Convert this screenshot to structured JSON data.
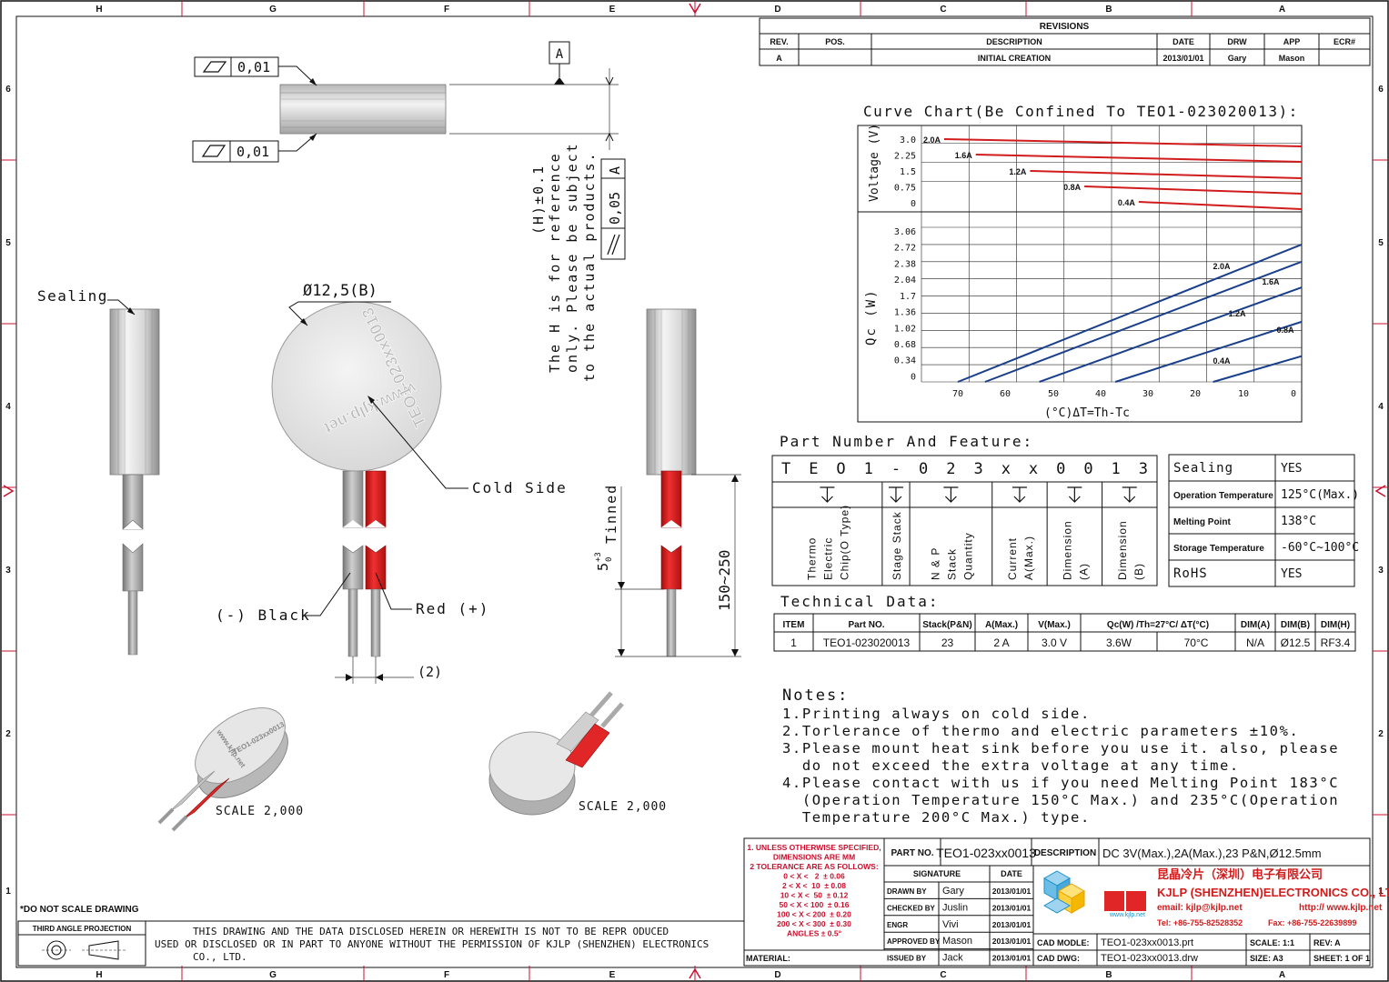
{
  "border": {
    "cols": [
      "H",
      "G",
      "F",
      "E",
      "D",
      "C",
      "B",
      "A"
    ],
    "rows": [
      "6",
      "5",
      "4",
      "3",
      "2",
      "1"
    ]
  },
  "revisions": {
    "title": "REVISIONS",
    "headers": [
      "REV.",
      "POS.",
      "DESCRIPTION",
      "DATE",
      "DRW",
      "APP",
      "ECR#"
    ],
    "row": [
      "A",
      "",
      "INITIAL CREATION",
      "2013/01/01",
      "Gary",
      "Mason",
      ""
    ]
  },
  "views": {
    "flatness_value": "0,01",
    "datum": "A",
    "parallel": {
      "value": "0,05",
      "datum": "A"
    },
    "height_note": [
      "(H)±0.1",
      "The H is for reference",
      "only. Please be subject",
      "to the actual products."
    ],
    "sealing": "Sealing",
    "diameter": "Ø12,5(B)",
    "disk_text": {
      "url": "www.kjlp.net",
      "part": "TEO1-023xx0013"
    },
    "cold_side": "Cold Side",
    "black": "(-) Black",
    "red": "Red (+)",
    "pitch": "(2)",
    "tinned": "5",
    "tinned_sup": "+3",
    "tinned_sub": "0",
    "tinned_label": "Tinned",
    "wire_length": "150~250",
    "scale1": "SCALE  2,000",
    "scale2": "SCALE  2,000"
  },
  "curve": {
    "title": "Curve Chart(Be Confined To TEO1-023020013):"
  },
  "chart_data": [
    {
      "type": "line",
      "ylabel": "Voltage (V)",
      "y_ticks": [
        "3.0",
        "2.25",
        "1.5",
        "0.75",
        "0"
      ],
      "x_range": [
        70,
        0
      ],
      "series": [
        {
          "name": "2.0A",
          "points": [
            [
              70,
              3.0
            ],
            [
              0,
              2.8
            ]
          ]
        },
        {
          "name": "1.6A",
          "points": [
            [
              60,
              2.25
            ],
            [
              0,
              2.05
            ]
          ]
        },
        {
          "name": "1.2A",
          "points": [
            [
              50,
              1.5
            ],
            [
              0,
              1.35
            ]
          ]
        },
        {
          "name": "0.8A",
          "points": [
            [
              40,
              0.75
            ],
            [
              0,
              0.6
            ]
          ]
        },
        {
          "name": "0.4A",
          "points": [
            [
              30,
              0.0
            ],
            [
              0,
              0.0
            ]
          ]
        }
      ]
    },
    {
      "type": "line",
      "ylabel": "Qc (W)",
      "xlabel": "(°C)ΔT=Th-Tc",
      "x_ticks": [
        "70",
        "60",
        "50",
        "40",
        "30",
        "20",
        "10",
        "0"
      ],
      "y_ticks": [
        "3.06",
        "2.72",
        "2.38",
        "2.04",
        "1.7",
        "1.36",
        "1.02",
        "0.68",
        "0.34",
        "0"
      ],
      "series": [
        {
          "name": "2.0A",
          "points": [
            [
              70,
              0
            ],
            [
              0,
              2.72
            ]
          ]
        },
        {
          "name": "1.6A",
          "points": [
            [
              65,
              0
            ],
            [
              0,
              2.38
            ]
          ]
        },
        {
          "name": "1.2A",
          "points": [
            [
              55,
              0
            ],
            [
              0,
              1.87
            ]
          ]
        },
        {
          "name": "0.8A",
          "points": [
            [
              41,
              0
            ],
            [
              0,
              1.19
            ]
          ]
        },
        {
          "name": "0.4A",
          "points": [
            [
              23,
              0
            ],
            [
              0,
              0.51
            ]
          ]
        }
      ]
    }
  ],
  "partnumber": {
    "title": "Part Number And Feature:",
    "chars": [
      "T",
      "E",
      "O",
      "1",
      "-",
      "0",
      "2",
      "3",
      "x",
      "x",
      "0",
      "0",
      "1",
      "3"
    ],
    "descriptions": [
      "Thermo Electric Chip(O Type)",
      "Stage Stack",
      "N & P Stack Quantity",
      "Current A(Max.)",
      "Dimension (A)",
      "Dimension (B)"
    ],
    "features": [
      [
        "Sealing",
        "YES"
      ],
      [
        "Operation Temperature",
        "125°C(Max.)"
      ],
      [
        "Melting Point",
        "138°C"
      ],
      [
        "Storage Temperature",
        "-60°C~100°C"
      ],
      [
        "RoHS",
        "YES"
      ]
    ]
  },
  "technical": {
    "title": "Technical Data:",
    "headers": [
      "ITEM",
      "Part NO.",
      "Stack(P&N)",
      "A(Max.)",
      "V(Max.)",
      "Qc(W) /Th=27°C/ ΔT(°C)",
      "DIM(A)",
      "DIM(B)",
      "DIM(H)"
    ],
    "row": [
      "1",
      "TEO1-023020013",
      "23",
      "2 A",
      "3.0 V",
      "3.6W",
      "70°C",
      "N/A",
      "Ø12.5",
      "RF3.4"
    ]
  },
  "notes": {
    "title": "Notes:",
    "lines": [
      "1.Printing always on cold side.",
      "2.Torlerance of thermo and electric parameters ±10%.",
      "3.Please mount heat sink before you use it. also, please",
      "  do not exceed the extra voltage at any time.",
      "4.Please contact with us if you need Melting Point 183°C",
      "  (Operation Temperature 150°C Max.) and 235°C(Operation",
      "  Temperature 200°C Max.) type."
    ]
  },
  "titleblock": {
    "tolerance": [
      "1. UNLESS OTHERWISE SPECIFIED,",
      "DIMENSIONS ARE MM",
      "2 TOLERANCE ARE AS FOLLOWS:",
      "0 < X <   2  ± 0.06",
      "2 < X <  10  ± 0.08",
      "10 < X <  50  ± 0.12",
      "50 < X < 100  ± 0.16",
      "100 < X < 200  ± 0.20",
      "200 < X < 300  ± 0.30",
      "ANGLES ± 0.5°"
    ],
    "part_no_label": "PART NO.",
    "part_no": "TEO1-023xx0013",
    "description_label": "DESCRIPTION",
    "description": "DC 3V(Max.),2A(Max.),23 P&N,Ø12.5mm",
    "signature_label": "SIGNATURE",
    "date_label": "DATE",
    "sign_rows": [
      [
        "DRAWN BY",
        "Gary",
        "2013/01/01"
      ],
      [
        "CHECKED BY",
        "Juslin",
        "2013/01/01"
      ],
      [
        "ENGR",
        "Vivi",
        "2013/01/01"
      ],
      [
        "APPROVED BY",
        "Mason",
        "2013/01/01"
      ],
      [
        "ISSUED BY",
        "Jack",
        "2013/01/01"
      ]
    ],
    "company_cn": "昆晶冷片（深圳）电子有限公司",
    "company_en": "KJLP (SHENZHEN)ELECTRONICS CO., LTD",
    "email": "email: kjlp@kjlp.net",
    "http": "http:// www.kjlp.net",
    "tel": "Tel: +86-755-82528352",
    "fax": "Fax: +86-755-22639899",
    "logo_url": "www.kjlp.net",
    "cad_model_label": "CAD MODLE:",
    "cad_model": "TEO1-023xx0013.prt",
    "cad_dwg_label": "CAD DWG:",
    "cad_dwg": "TEO1-023xx0013.drw",
    "scale_label": "SCALE: 1:1",
    "rev_label": "REV: A",
    "size_label": "SIZE: A3",
    "sheet_label": "SHEET: 1 OF 1",
    "material_label": "MATERIAL:",
    "do_not_scale": "*DO NOT SCALE DRAWING",
    "third_angle": "THIRD ANGLE PROJECTION",
    "disclaimer": [
      "THIS DRAWING AND THE DATA DISCLOSED HEREIN OR HEREWITH IS NOT TO BE REPR ODUCED",
      "USED OR DISCLOSED OR IN PART TO ANYONE WITHOUT THE PERMISSION OF KJLP (SHENZHEN) ELECTRONICS",
      "CO., LTD."
    ]
  }
}
